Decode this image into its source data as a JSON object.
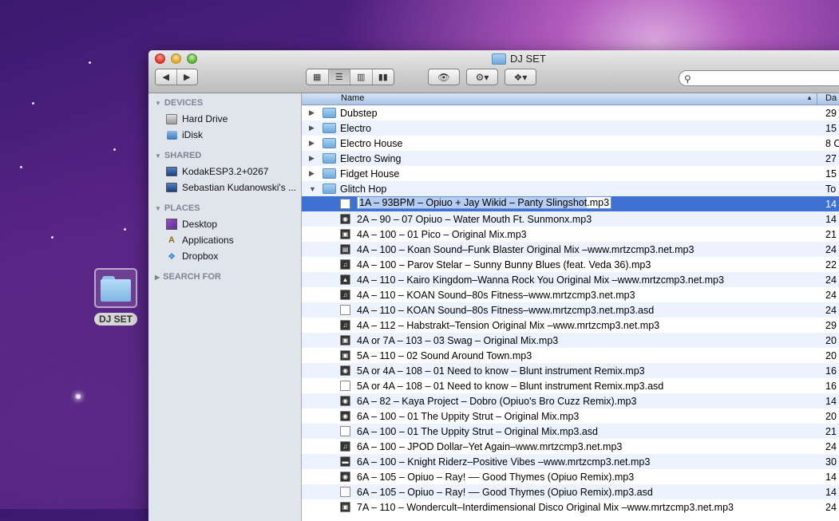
{
  "desktop": {
    "icon_label": "DJ SET"
  },
  "window": {
    "title": "DJ SET",
    "search": {
      "placeholder": ""
    }
  },
  "sidebar": {
    "devices": {
      "header": "DEVICES",
      "items": [
        {
          "label": "Hard Drive",
          "icon": "hard-drive-icon"
        },
        {
          "label": "iDisk",
          "icon": "idisk-icon"
        }
      ]
    },
    "shared": {
      "header": "SHARED",
      "items": [
        {
          "label": "KodakESP3.2+0267",
          "icon": "computer-icon"
        },
        {
          "label": "Sebastian Kudanowski's ...",
          "icon": "computer-icon"
        }
      ]
    },
    "places": {
      "header": "PLACES",
      "items": [
        {
          "label": "Desktop",
          "icon": "desktop-icon"
        },
        {
          "label": "Applications",
          "icon": "applications-icon"
        },
        {
          "label": "Dropbox",
          "icon": "dropbox-icon"
        }
      ]
    },
    "search_for": {
      "header": "SEARCH FOR"
    }
  },
  "list": {
    "columns": {
      "name": "Name",
      "date": "Da"
    },
    "folders": [
      {
        "name": "Dubstep",
        "date": "29"
      },
      {
        "name": "Electro",
        "date": "15"
      },
      {
        "name": "Electro House",
        "date": "8 C"
      },
      {
        "name": "Electro Swing",
        "date": "27"
      },
      {
        "name": "Fidget House",
        "date": "15"
      },
      {
        "name": "Glitch Hop",
        "date": "To"
      }
    ],
    "selected_file": {
      "name_pre": "1A –   93BPM – Opiuo + Jay Wikid – Panty Slingshot",
      "name_ext": ".mp3",
      "date": "14"
    },
    "files": [
      {
        "name": "2A –   90 – 07 Opiuo – Water Mouth Ft. Sunmonx.mp3",
        "date": "14"
      },
      {
        "name": "4A – 100 – 01 Pico – Original Mix.mp3",
        "date": "21"
      },
      {
        "name": "4A – 100 – Koan Sound–Funk Blaster  Original Mix –www.mrtzcmp3.net.mp3",
        "date": "24"
      },
      {
        "name": "4A – 100 – Parov Stelar – Sunny Bunny Blues (feat. Veda 36).mp3",
        "date": "22"
      },
      {
        "name": "4A – 110 – Kairo Kingdom–Wanna Rock You  Original Mix –www.mrtzcmp3.net.mp3",
        "date": "24"
      },
      {
        "name": "4A – 110 – KOAN Sound–80s Fitness–www.mrtzcmp3.net.mp3",
        "date": "24"
      },
      {
        "name": "4A – 110 – KOAN Sound–80s Fitness–www.mrtzcmp3.net.mp3.asd",
        "date": "24"
      },
      {
        "name": "4A – 112 – Habstrakt–Tension  Original Mix –www.mrtzcmp3.net.mp3",
        "date": "29"
      },
      {
        "name": "4A or 7A – 103 – 03 Swag – Original Mix.mp3",
        "date": "20"
      },
      {
        "name": "5A – 110 – 02 Sound Around Town.mp3",
        "date": "20"
      },
      {
        "name": "5A or 4A – 108 – 01 Need to know – Blunt instrument Remix.mp3",
        "date": "16"
      },
      {
        "name": "5A or 4A – 108 – 01 Need to know – Blunt instrument Remix.mp3.asd",
        "date": "16"
      },
      {
        "name": "6A –   82 – Kaya Project – Dobro (Opiuo's Bro Cuzz Remix).mp3",
        "date": "14"
      },
      {
        "name": "6A – 100 – 01 The Uppity Strut – Original Mix.mp3",
        "date": "20"
      },
      {
        "name": "6A – 100 – 01 The Uppity Strut – Original Mix.mp3.asd",
        "date": "21"
      },
      {
        "name": "6A – 100 – JPOD Dollar–Yet Again–www.mrtzcmp3.net.mp3",
        "date": "24"
      },
      {
        "name": "6A – 100 – Knight Riderz–Positive Vibes –www.mrtzcmp3.net.mp3",
        "date": "30"
      },
      {
        "name": "6A – 105 – Opiuo – Ray! –– Good Thymes (Opiuo Remix).mp3",
        "date": "14"
      },
      {
        "name": "6A – 105 – Opiuo – Ray! –– Good Thymes (Opiuo Remix).mp3.asd",
        "date": "14"
      },
      {
        "name": "7A – 110 – Wondercult–Interdimensional Disco  Original Mix –www.mrtzcmp3.net.mp3",
        "date": "24"
      }
    ]
  }
}
